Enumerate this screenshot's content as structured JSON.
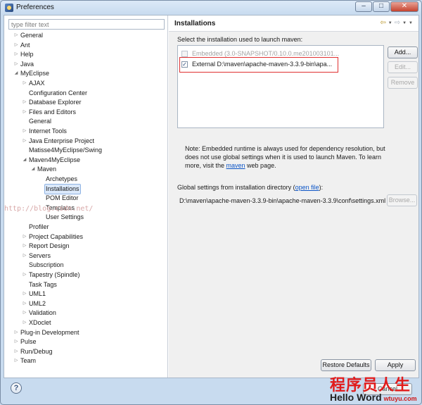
{
  "window": {
    "title": "Preferences"
  },
  "filter": {
    "placeholder": "type filter text"
  },
  "tree": [
    {
      "label": "General",
      "arrow": "collapsed"
    },
    {
      "label": "Ant",
      "arrow": "collapsed"
    },
    {
      "label": "Help",
      "arrow": "collapsed"
    },
    {
      "label": "Java",
      "arrow": "collapsed"
    },
    {
      "label": "MyEclipse",
      "arrow": "expanded"
    },
    {
      "label": "AJAX",
      "arrow": "collapsed"
    },
    {
      "label": "Configuration Center",
      "arrow": "none"
    },
    {
      "label": "Database Explorer",
      "arrow": "collapsed"
    },
    {
      "label": "Files and Editors",
      "arrow": "collapsed"
    },
    {
      "label": "General",
      "arrow": "none"
    },
    {
      "label": "Internet Tools",
      "arrow": "collapsed"
    },
    {
      "label": "Java Enterprise Project",
      "arrow": "collapsed"
    },
    {
      "label": "Matisse4MyEclipse/Swing",
      "arrow": "none"
    },
    {
      "label": "Maven4MyEclipse",
      "arrow": "expanded"
    },
    {
      "label": "Maven",
      "arrow": "expanded"
    },
    {
      "label": "Archetypes",
      "arrow": "none"
    },
    {
      "label": "Installations",
      "arrow": "none",
      "selected": true
    },
    {
      "label": "POM Editor",
      "arrow": "none"
    },
    {
      "label": "Templates",
      "arrow": "none"
    },
    {
      "label": "User Settings",
      "arrow": "none"
    },
    {
      "label": "Profiler",
      "arrow": "none"
    },
    {
      "label": "Project Capabilities",
      "arrow": "collapsed"
    },
    {
      "label": "Report Design",
      "arrow": "collapsed"
    },
    {
      "label": "Servers",
      "arrow": "collapsed"
    },
    {
      "label": "Subscription",
      "arrow": "none"
    },
    {
      "label": "Tapestry (Spindle)",
      "arrow": "collapsed"
    },
    {
      "label": "Task Tags",
      "arrow": "none"
    },
    {
      "label": "UML1",
      "arrow": "collapsed"
    },
    {
      "label": "UML2",
      "arrow": "collapsed"
    },
    {
      "label": "Validation",
      "arrow": "collapsed"
    },
    {
      "label": "XDoclet",
      "arrow": "collapsed"
    },
    {
      "label": "Plug-in Development",
      "arrow": "collapsed"
    },
    {
      "label": "Pulse",
      "arrow": "collapsed"
    },
    {
      "label": "Run/Debug",
      "arrow": "collapsed"
    },
    {
      "label": "Team",
      "arrow": "collapsed"
    }
  ],
  "page": {
    "title": "Installations",
    "select_label": "Select the installation used to launch maven:",
    "installations": [
      {
        "label": "Embedded (3.0-SNAPSHOT/0.10.0.me201003101...",
        "checked": false,
        "enabled": false
      },
      {
        "label": "External D:\\maven\\apache-maven-3.3.9-bin\\apa...",
        "checked": true,
        "enabled": true
      }
    ],
    "buttons": {
      "add": "Add...",
      "edit": "Edit...",
      "remove": "Remove",
      "browse": "Browse..."
    },
    "note_text": "Note: Embedded runtime is always used for dependency resolution, but does not use global settings when it is used to launch Maven. To learn more, visit the ",
    "note_link": "maven",
    "note_tail": " web page.",
    "global_label": "Global settings from installation directory (",
    "global_link": "open file",
    "global_tail": "):",
    "global_path": "D:\\maven\\apache-maven-3.3.9-bin\\apache-maven-3.3.9\\conf\\settings.xml",
    "restore_defaults": "Restore Defaults",
    "apply": "Apply"
  },
  "watermark": "http://blog.csdn.net/",
  "bottom": {
    "cancel": "Cancel"
  },
  "logo": {
    "cn": "程序员人生",
    "en": "Hello Word",
    "site": "wtuyu.com"
  },
  "colors": {
    "link": "#0b54c6",
    "highlight": "#e03030",
    "selection": "#dbe9fb"
  }
}
